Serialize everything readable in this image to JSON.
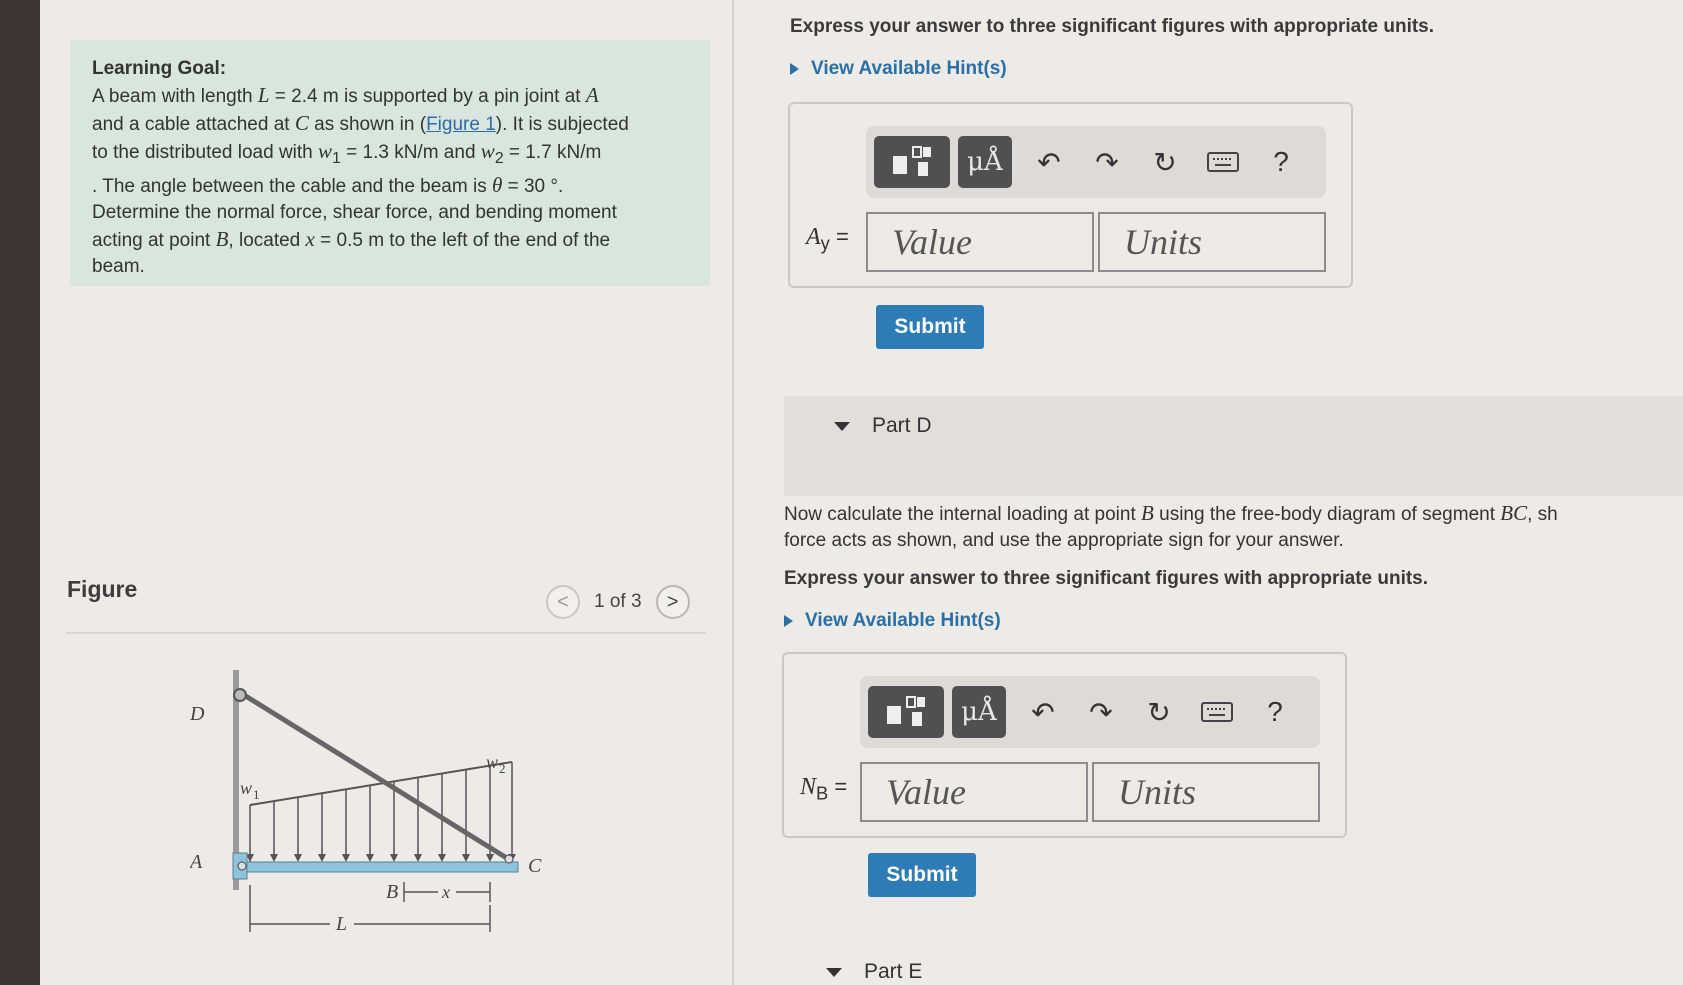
{
  "learning_goal": {
    "title": "Learning Goal:",
    "l1_a": "A beam with length ",
    "l1_L": "L",
    "l1_b": " = 2.4 m is supported by a pin joint at ",
    "l1_A": "A",
    "l2_a": "and a cable attached at ",
    "l2_C": "C",
    "l2_b": " as shown in (",
    "l2_link": "Figure 1",
    "l2_c": "). It is subjected",
    "l3_a": "to the distributed load with ",
    "l3_w1": "w",
    "l3_w1_sub": "1",
    "l3_b": " = 1.3 kN/m and ",
    "l3_w2": "w",
    "l3_w2_sub": "2",
    "l3_c": " = 1.7 kN/m",
    "l4_a": ". The angle between the cable and the beam is ",
    "l4_theta": "θ",
    "l4_b": " = 30 °.",
    "l5": "Determine the normal force, shear force, and bending moment",
    "l6_a": "acting at point ",
    "l6_B": "B",
    "l6_b": ", located ",
    "l6_x": "x",
    "l6_c": " = 0.5 m to the left of the end of the",
    "l7": "beam."
  },
  "figure": {
    "heading": "Figure",
    "pager": "1 of 3",
    "prev": "<",
    "next": ">",
    "labels": {
      "D": "D",
      "A": "A",
      "C": "C",
      "B": "B",
      "x": "x",
      "L": "L",
      "w1": "w",
      "w1_sub": "1",
      "w2": "w",
      "w2_sub": "2"
    }
  },
  "part_c": {
    "instruction": "Express your answer to three significant figures with appropriate units.",
    "hint": "View Available Hint(s)",
    "label_main": "A",
    "label_sub": "y",
    "label_eq": " =",
    "value_placeholder": "Value",
    "units_placeholder": "Units",
    "submit": "Submit"
  },
  "part_d": {
    "title": "Part D",
    "para_l1_a": "Now calculate the internal loading at point ",
    "para_l1_B": "B",
    "para_l1_b": " using the free-body diagram of segment ",
    "para_l1_BC": "BC",
    "para_l1_c": ", sh",
    "para_l2": "force acts as shown, and use the appropriate sign for your answer.",
    "instruction": "Express your answer to three significant figures with appropriate units.",
    "hint": "View Available Hint(s)",
    "label_main": "N",
    "label_sub": "B",
    "label_eq": " =",
    "value_placeholder": "Value",
    "units_placeholder": "Units",
    "submit": "Submit"
  },
  "part_e": {
    "title": "Part E"
  },
  "toolbar": {
    "mu_label": "μÅ",
    "help": "?"
  },
  "colors": {
    "accent": "#2d7cb6",
    "link": "#2a6fa6",
    "goal_bg": "#d9e5df",
    "beam": "#8fc3d9"
  }
}
